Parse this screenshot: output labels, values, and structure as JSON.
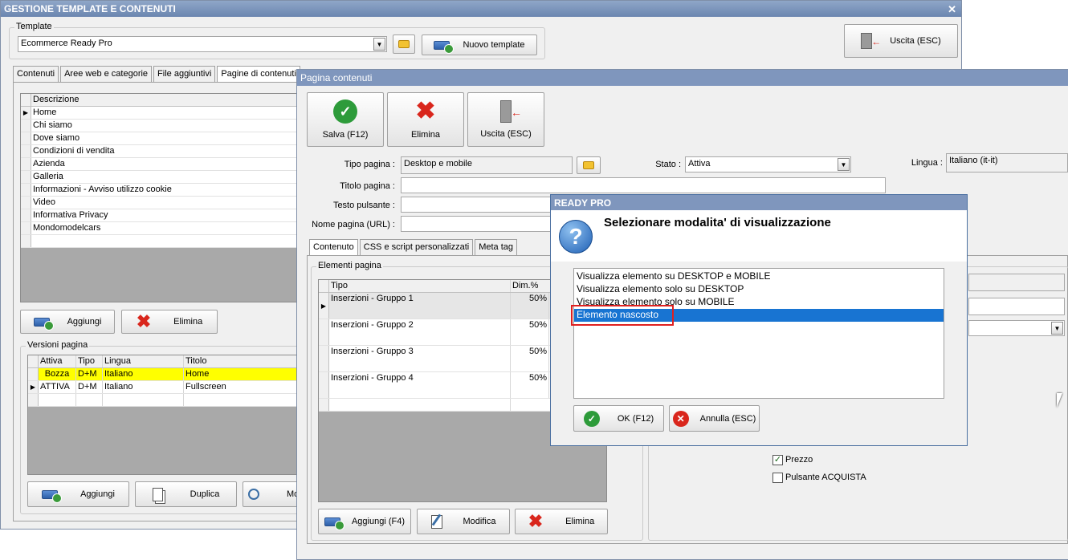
{
  "main": {
    "title": "GESTIONE TEMPLATE E CONTENUTI",
    "template_group_label": "Template",
    "template_value": "Ecommerce Ready Pro",
    "new_template_label": "Nuovo template",
    "exit_label": "Uscita (ESC)",
    "tabs": [
      "Contenuti",
      "Aree web e categorie",
      "File aggiuntivi",
      "Pagine di contenuti"
    ],
    "pages_header": "Descrizione",
    "pages": [
      "Home",
      "Chi siamo",
      "Dove siamo",
      "Condizioni di vendita",
      "Azienda",
      "Galleria",
      "Informazioni - Avviso utilizzo cookie",
      "Video",
      "Informativa Privacy",
      "Mondomodelcars"
    ],
    "add_label": "Aggiungi",
    "delete_label": "Elimina",
    "versions_label": "Versioni pagina",
    "versions_headers": [
      "Attiva",
      "Tipo",
      "Lingua",
      "Titolo"
    ],
    "versions": [
      {
        "attiva": "Bozza",
        "tipo": "D+M",
        "lingua": "Italiano",
        "titolo": "Home"
      },
      {
        "attiva": "ATTIVA",
        "tipo": "D+M",
        "lingua": "Italiano",
        "titolo": "Fullscreen"
      }
    ],
    "bottom_add": "Aggiungi",
    "bottom_duplicate": "Duplica",
    "bottom_more": "Mo"
  },
  "content_page": {
    "title": "Pagina contenuti",
    "save_label": "Salva (F12)",
    "delete_label": "Elimina",
    "exit_label": "Uscita (ESC)",
    "page_type_label": "Tipo pagina :",
    "page_type_value": "Desktop e mobile",
    "status_label": "Stato :",
    "status_value": "Attiva",
    "language_label": "Lingua :",
    "language_value": "Italiano (it-it)",
    "page_title_label": "Titolo pagina :",
    "page_title_value": "",
    "button_text_label": "Testo pulsante :",
    "page_name_label": "Nome pagina (URL) :",
    "tabs": [
      "Contenuto",
      "CSS e script personalizzati",
      "Meta tag"
    ],
    "elements_label": "Elementi pagina",
    "elements_headers": [
      "Tipo",
      "Dim.%"
    ],
    "elements": [
      {
        "tipo": "Inserzioni - Gruppo 1",
        "dim": "50%"
      },
      {
        "tipo": "Inserzioni - Gruppo 2",
        "dim": "50%"
      },
      {
        "tipo": "Inserzioni - Gruppo 3",
        "dim": "50%"
      },
      {
        "tipo": "Inserzioni - Gruppo 4",
        "dim": "50%"
      }
    ],
    "add_label": "Aggiungi (F4)",
    "edit_label": "Modifica",
    "delete_btn_label": "Elimina",
    "checkbox_price": "Prezzo",
    "checkbox_buy": "Pulsante ACQUISTA"
  },
  "dialog": {
    "title": "READY PRO",
    "message": "Selezionare modalita' di visualizzazione",
    "options": [
      "Visualizza elemento su DESKTOP e MOBILE",
      "Visualizza elemento solo su DESKTOP",
      "Visualizza elemento solo su MOBILE",
      "Elemento nascosto"
    ],
    "selected_index": 3,
    "ok_label": "OK (F12)",
    "cancel_label": "Annulla (ESC)"
  }
}
